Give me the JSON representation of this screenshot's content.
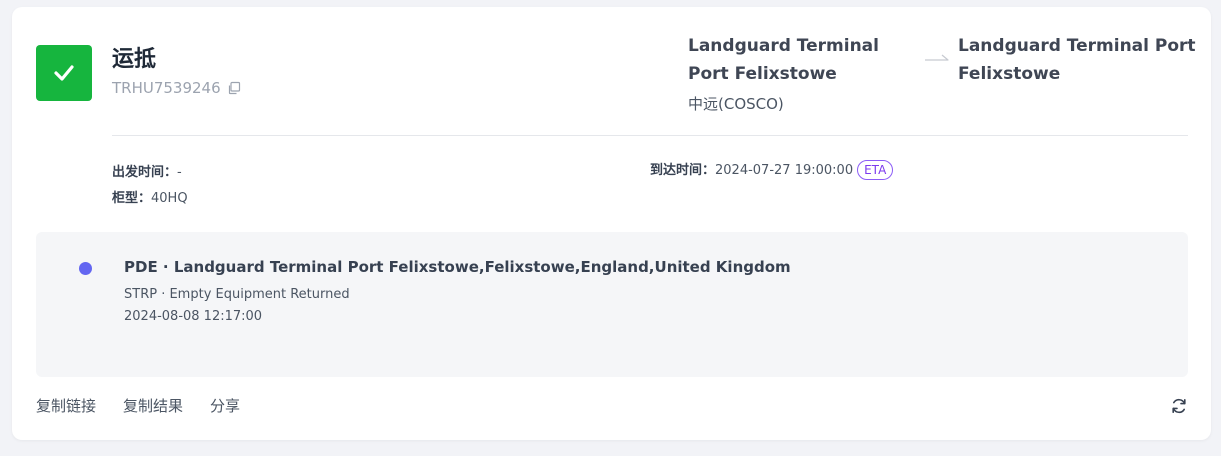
{
  "status": {
    "title": "运抵",
    "container_number": "TRHU7539246",
    "color": "#16b53e"
  },
  "route": {
    "from": "Landguard Terminal Port Felixstowe",
    "to": "Landguard Terminal Port Felixstowe",
    "carrier": "中远(COSCO)"
  },
  "meta": {
    "departure_label": "出发时间：",
    "departure_value": "-",
    "arrival_label": "到达时间：",
    "arrival_value": "2024-07-27 19:00:00",
    "arrival_badge": "ETA",
    "container_type_label": "柜型：",
    "container_type_value": "40HQ"
  },
  "event": {
    "title": "PDE · Landguard Terminal Port Felixstowe,Felixstowe,England,United Kingdom",
    "status": "STRP · Empty Equipment Returned",
    "time": "2024-08-08 12:17:00",
    "dot_color": "#6366f1"
  },
  "actions": {
    "copy_link": "复制链接",
    "copy_result": "复制结果",
    "share": "分享"
  },
  "icons": {
    "status": "check-icon",
    "copy": "copy-icon",
    "arrow": "arrow-right-icon",
    "refresh": "refresh-icon"
  }
}
